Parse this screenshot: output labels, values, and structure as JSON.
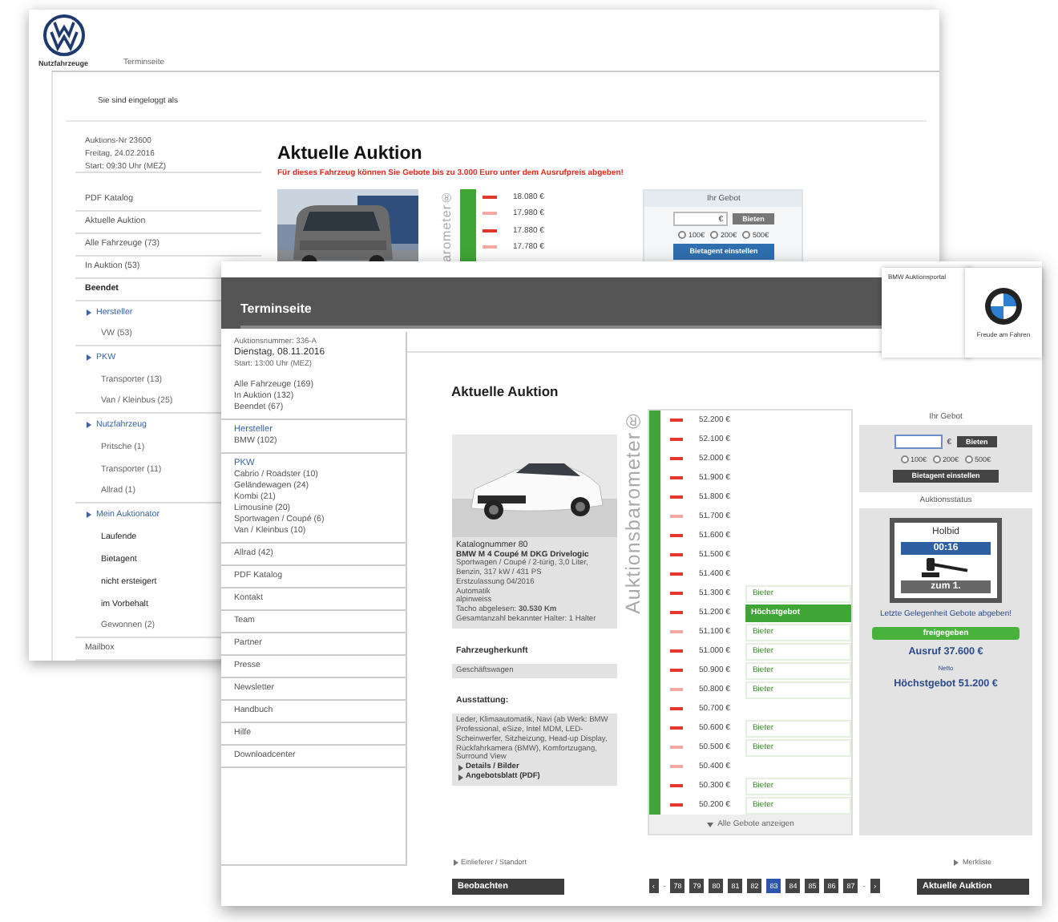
{
  "back_window": {
    "brand": "Nutzfahrzeuge",
    "nav_link": "Terminseite",
    "login_text": "Sie sind eingeloggt als",
    "sidebar": [
      {
        "kind": "meta",
        "label": "Auktions-Nr 23600",
        "divider": false
      },
      {
        "kind": "meta",
        "label": "Freitag, 24.02.2016",
        "divider": false
      },
      {
        "kind": "meta",
        "label": "Start: 09:30 Uhr (MEZ)",
        "divider": true
      },
      {
        "kind": "link",
        "label": "PDF Katalog",
        "divider": true
      },
      {
        "kind": "link",
        "label": "Aktuelle Auktion",
        "divider": true
      },
      {
        "kind": "link",
        "label": "Alle Fahrzeuge (73)",
        "divider": true
      },
      {
        "kind": "link",
        "label": "In Auktion (53)",
        "divider": true
      },
      {
        "kind": "strong",
        "label": "Beendet",
        "divider": true
      },
      {
        "kind": "heading",
        "label": "Hersteller",
        "divider": false
      },
      {
        "kind": "sub",
        "label": "VW (53)",
        "divider": true
      },
      {
        "kind": "heading",
        "label": "PKW",
        "divider": false
      },
      {
        "kind": "sub",
        "label": "Transporter (13)",
        "divider": false
      },
      {
        "kind": "sub",
        "label": "Van / Kleinbus (25)",
        "divider": true
      },
      {
        "kind": "heading",
        "label": "Nutzfahrzeug",
        "divider": false
      },
      {
        "kind": "sub",
        "label": "Pritsche (1)",
        "divider": false
      },
      {
        "kind": "sub",
        "label": "Transporter (11)",
        "divider": false
      },
      {
        "kind": "sub",
        "label": "Allrad (1)",
        "divider": true
      },
      {
        "kind": "heading",
        "label": "Mein Auktionator",
        "divider": false
      },
      {
        "kind": "strongsub",
        "label": "Laufende",
        "divider": false
      },
      {
        "kind": "strongsub",
        "label": "Bietagent",
        "divider": false
      },
      {
        "kind": "strongsub",
        "label": "nicht ersteigert",
        "divider": false
      },
      {
        "kind": "strongsub",
        "label": "im Vorbehalt",
        "divider": false
      },
      {
        "kind": "sub",
        "label": "Gewonnen (2)",
        "divider": true
      },
      {
        "kind": "link",
        "label": "Mailbox",
        "divider": true
      }
    ],
    "main": {
      "title": "Aktuelle Auktion",
      "notice": "Für dieses Fahrzeug können Sie Gebote bis zu 3.000 Euro unter dem Ausrufpreis abgeben!",
      "barometer": "arometer®",
      "bids": [
        {
          "amount": "18.080 €",
          "faded": false
        },
        {
          "amount": "17.980 €",
          "faded": true
        },
        {
          "amount": "17.880 €",
          "faded": false
        },
        {
          "amount": "17.780 €",
          "faded": true
        }
      ],
      "bid_panel": {
        "title": "Ihr Gebot",
        "currency": "€",
        "button": "Bieten",
        "options": [
          {
            "label": "100€",
            "selected": false
          },
          {
            "label": "200€",
            "selected": false
          },
          {
            "label": "500€",
            "selected": false
          }
        ],
        "agent_button": "Bietagent einstellen"
      }
    }
  },
  "front_window": {
    "header_title": "Terminseite",
    "portal_label": "BMW Auktionsportal",
    "slogan": "Freude am Fahren",
    "sidebar": [
      {
        "divider": false,
        "items": [
          {
            "kind": "meta",
            "label": "Auktionsnummer: 336-A"
          },
          {
            "kind": "date",
            "label": "Dienstag, 08.11.2016"
          },
          {
            "kind": "meta",
            "label": "Start: 13:00 Uhr (MEZ)"
          }
        ]
      },
      {
        "divider": true,
        "items": [
          {
            "kind": "link",
            "label": "Alle Fahrzeuge (169)"
          },
          {
            "kind": "link",
            "label": "In Auktion (132)"
          },
          {
            "kind": "link",
            "label": "Beendet (67)"
          }
        ]
      },
      {
        "divider": true,
        "items": [
          {
            "kind": "heading",
            "label": "Hersteller"
          },
          {
            "kind": "link",
            "label": "BMW (102)"
          }
        ]
      },
      {
        "divider": true,
        "items": [
          {
            "kind": "heading",
            "label": "PKW"
          },
          {
            "kind": "link",
            "label": "Cabrio / Roadster (10)"
          },
          {
            "kind": "link",
            "label": "Geländewagen (24)"
          },
          {
            "kind": "link",
            "label": "Kombi (21)"
          },
          {
            "kind": "link",
            "label": "Limousine (20)"
          },
          {
            "kind": "link",
            "label": "Sportwagen / Coupé (6)"
          },
          {
            "kind": "link",
            "label": "Van / Kleinbus (10)"
          }
        ]
      },
      {
        "divider": true,
        "items": [
          {
            "kind": "link",
            "label": "Allrad (42)"
          }
        ]
      },
      {
        "divider": true,
        "items": [
          {
            "kind": "link",
            "label": "PDF Katalog"
          }
        ]
      },
      {
        "divider": true,
        "items": [
          {
            "kind": "link",
            "label": "Kontakt"
          }
        ]
      },
      {
        "divider": true,
        "items": [
          {
            "kind": "link",
            "label": "Team"
          }
        ]
      },
      {
        "divider": true,
        "items": [
          {
            "kind": "link",
            "label": "Partner"
          }
        ]
      },
      {
        "divider": true,
        "items": [
          {
            "kind": "link",
            "label": "Presse"
          }
        ]
      },
      {
        "divider": true,
        "items": [
          {
            "kind": "link",
            "label": "Newsletter"
          }
        ]
      },
      {
        "divider": true,
        "items": [
          {
            "kind": "link",
            "label": "Handbuch"
          }
        ]
      },
      {
        "divider": true,
        "items": [
          {
            "kind": "link",
            "label": "Hilfe"
          }
        ]
      },
      {
        "divider": true,
        "items": [
          {
            "kind": "link",
            "label": "Downloadcenter"
          }
        ]
      }
    ],
    "main": {
      "title": "Aktuelle Auktion",
      "vehicle": {
        "catalog": "Katalognummer 80",
        "model": "BMW M 4 Coupé M DKG Drivelogic",
        "specs": [
          "Sportwagen / Coupé / 2-türig, 3,0 Liter, Benzin, 317 kW / 431 PS",
          "Erstzulassung 04/2016",
          "Automatik",
          "alpinweiss",
          "Tacho abgelesen: **30.530 Km**",
          "Gesamtanzahl bekannter Halter: 1 Halter"
        ],
        "sections": [
          {
            "title": "Fahrzeugherkunft",
            "text": "Geschäftswagen"
          },
          {
            "title": "Ausstattung:",
            "text": "Leder, Klimaautomatik, Navi (ab Werk: BMW Professional, eSize, Intel MDM, LED-Scheinwerfer, Sitzheizung, Head-up Display, Rückfahrkamera (BMW), Komfortzugang, Surround View"
          }
        ],
        "links": [
          "Details / Bilder",
          "Angebotsblatt (PDF)"
        ]
      },
      "barometer": "Auktionsbarometer®",
      "bids": [
        {
          "amount": "52.200 €",
          "faded": false,
          "selected": false
        },
        {
          "amount": "52.100 €",
          "faded": false,
          "selected": false
        },
        {
          "amount": "52.000 €",
          "faded": false,
          "selected": false
        },
        {
          "amount": "51.900 €",
          "faded": false,
          "selected": false
        },
        {
          "amount": "51.800 €",
          "faded": false,
          "selected": false
        },
        {
          "amount": "51.700 €",
          "faded": true,
          "selected": false
        },
        {
          "amount": "51.600 €",
          "faded": false,
          "selected": false
        },
        {
          "amount": "51.500 €",
          "faded": false,
          "selected": false
        },
        {
          "amount": "51.400 €",
          "faded": false,
          "selected": false
        },
        {
          "amount": "51.300 €",
          "faded": false,
          "bidder": "Bieter",
          "selected": false
        },
        {
          "amount": "51.200 €",
          "faded": false,
          "bidder": "Höchstgebot",
          "selected": true
        },
        {
          "amount": "51.100 €",
          "faded": true,
          "bidder": "Bieter",
          "selected": false
        },
        {
          "amount": "51.000 €",
          "faded": false,
          "bidder": "Bieter",
          "selected": false
        },
        {
          "amount": "50.900 €",
          "faded": false,
          "bidder": "Bieter",
          "selected": false
        },
        {
          "amount": "50.800 €",
          "faded": true,
          "bidder": "Bieter",
          "selected": false
        },
        {
          "amount": "50.700 €",
          "faded": false,
          "selected": false
        },
        {
          "amount": "50.600 €",
          "faded": false,
          "bidder": "Bieter",
          "selected": false
        },
        {
          "amount": "50.500 €",
          "faded": true,
          "bidder": "Bieter",
          "selected": false
        },
        {
          "amount": "50.400 €",
          "faded": true,
          "selected": false
        },
        {
          "amount": "50.300 €",
          "faded": false,
          "bidder": "Bieter",
          "selected": false
        },
        {
          "amount": "50.200 €",
          "faded": false,
          "bidder": "Bieter",
          "selected": false
        }
      ],
      "show_all": "Alle Gebote anzeigen",
      "bid_panel": {
        "title": "Ihr Gebot",
        "currency": "€",
        "button": "Bieten",
        "options": [
          {
            "label": "100€",
            "selected": false
          },
          {
            "label": "200€",
            "selected": false
          },
          {
            "label": "500€",
            "selected": false
          }
        ],
        "agent_button": "Bietagent einstellen"
      },
      "status": {
        "title": "Auktionsstatus",
        "lot": "Holbid",
        "countdown": "00:16",
        "call": "zum 1.",
        "message": "Letzte Gelegenheit Gebote abgeben!",
        "badge": "freigegeben",
        "start_price": "Ausruf 37.600 €",
        "net": "Netto",
        "highest": "Höchstgebot 51.200 €"
      },
      "footer": {
        "left_link": "Einlieferer / Standort",
        "left_button": "Beobachten",
        "right_link": "Merkliste",
        "right_button": "Aktuelle Auktion",
        "pagination": [
          {
            "kind": "arrow",
            "label": "‹"
          },
          {
            "kind": "gap",
            "label": "-"
          },
          {
            "kind": "page",
            "label": "78",
            "selected": false
          },
          {
            "kind": "page",
            "label": "79",
            "selected": false
          },
          {
            "kind": "page",
            "label": "80",
            "selected": false
          },
          {
            "kind": "page",
            "label": "81",
            "selected": false
          },
          {
            "kind": "page",
            "label": "82",
            "selected": false
          },
          {
            "kind": "page",
            "label": "83",
            "selected": true
          },
          {
            "kind": "page",
            "label": "84",
            "selected": false
          },
          {
            "kind": "page",
            "label": "85",
            "selected": false
          },
          {
            "kind": "page",
            "label": "86",
            "selected": false
          },
          {
            "kind": "page",
            "label": "87",
            "selected": false
          },
          {
            "kind": "gap",
            "label": "-"
          },
          {
            "kind": "arrow",
            "label": "›"
          }
        ]
      }
    }
  }
}
